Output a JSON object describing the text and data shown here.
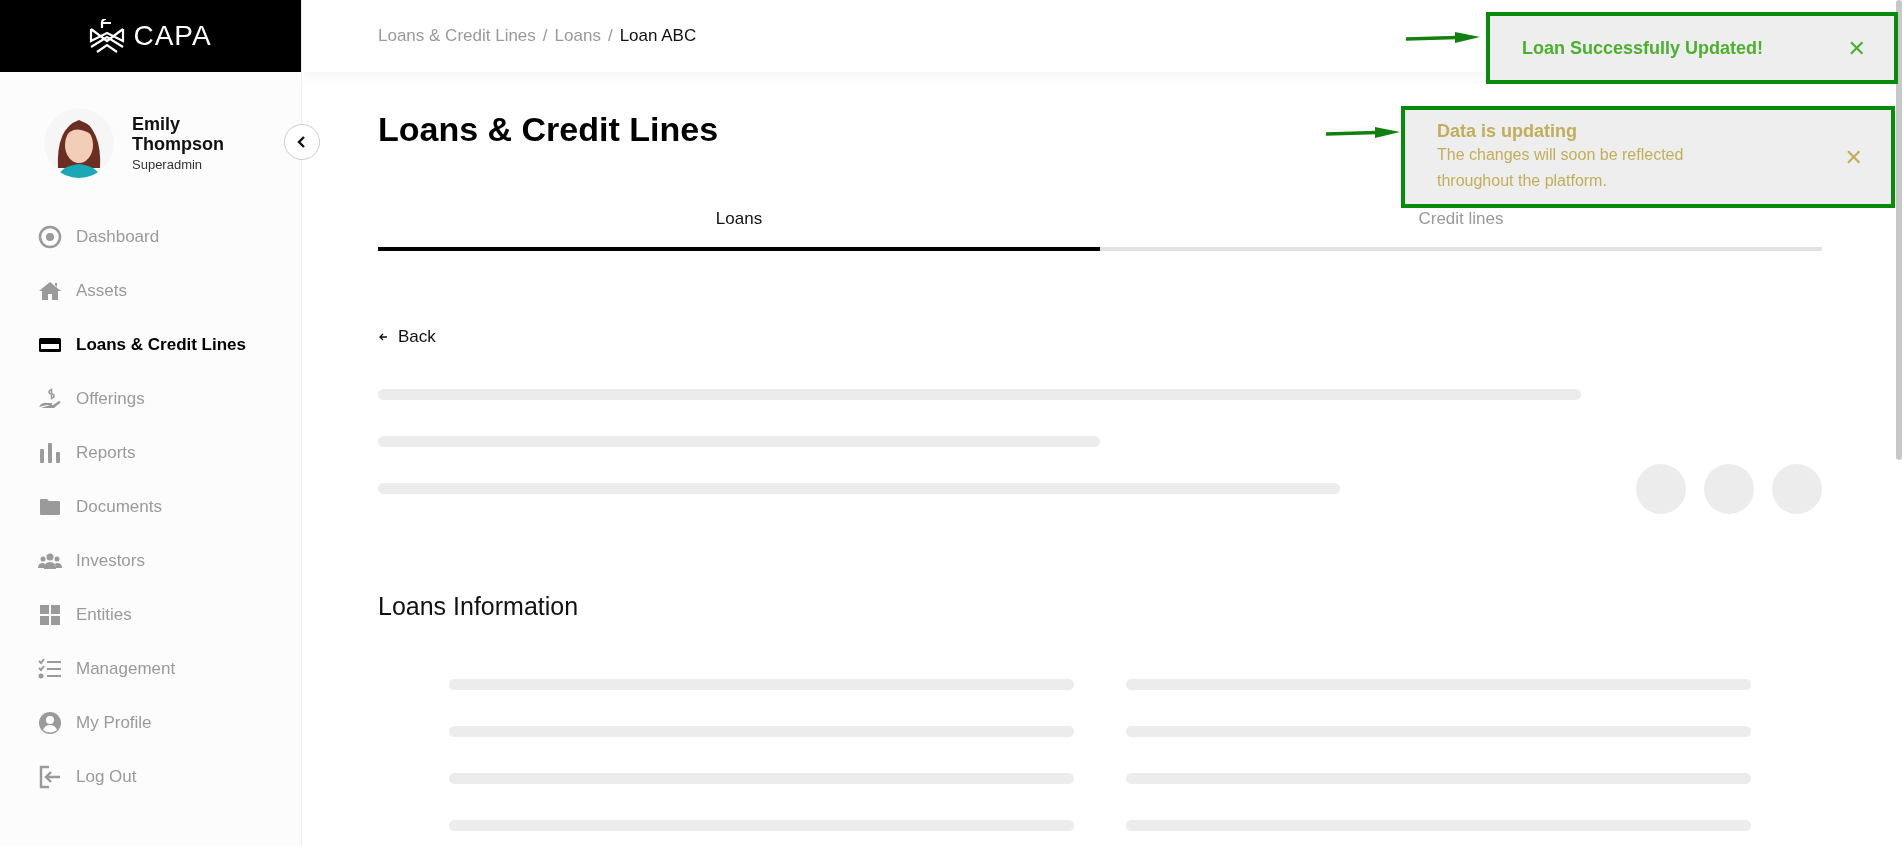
{
  "logo": {
    "text": "CAPA"
  },
  "user": {
    "name": "Emily Thompson",
    "role": "Superadmin"
  },
  "sidebar": {
    "items": [
      {
        "label": "Dashboard",
        "selected": false
      },
      {
        "label": "Assets",
        "selected": false
      },
      {
        "label": "Loans & Credit Lines",
        "selected": true
      },
      {
        "label": "Offerings",
        "selected": false
      },
      {
        "label": "Reports",
        "selected": false
      },
      {
        "label": "Documents",
        "selected": false
      },
      {
        "label": "Investors",
        "selected": false
      },
      {
        "label": "Entities",
        "selected": false
      },
      {
        "label": "Management",
        "selected": false
      },
      {
        "label": "My Profile",
        "selected": false
      },
      {
        "label": "Log Out",
        "selected": false
      }
    ]
  },
  "breadcrumb": [
    {
      "label": "Loans & Credit Lines",
      "current": false
    },
    {
      "separator": "/",
      "label": "Loans",
      "current": false
    },
    {
      "separator": "/",
      "label": "Loan ABC",
      "current": true
    }
  ],
  "page_title": "Loans & Credit Lines",
  "tabs": [
    {
      "label": "Loans",
      "selected": true
    },
    {
      "label": "Credit lines",
      "selected": false
    }
  ],
  "back_link": "Back",
  "section_title": "Loans Information",
  "toasts": [
    {
      "kind": "success",
      "title": "Loan Successfully Updated!",
      "close": "✕",
      "color": "#4caf2f"
    },
    {
      "kind": "info",
      "title": "Data is updating",
      "message": "The changes will soon be reflected throughout the platform.",
      "close": "✕",
      "color": "#c2ae5a"
    }
  ]
}
